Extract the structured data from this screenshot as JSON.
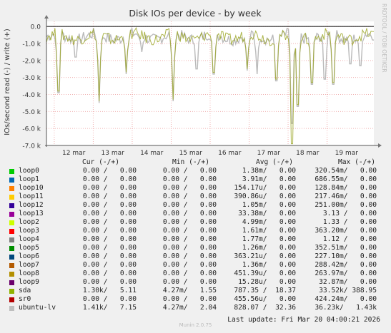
{
  "chart_data": {
    "type": "line",
    "title": "Disk IOs per device - by week",
    "ylabel": "IOs/second read (-) / write (+)",
    "xlabel": "",
    "ylim": [
      -7000,
      300
    ],
    "y_ticks": [
      {
        "value": 0,
        "label": "0.0"
      },
      {
        "value": -1000,
        "label": "-1.0 k"
      },
      {
        "value": -2000,
        "label": "-2.0 k"
      },
      {
        "value": -3000,
        "label": "-3.0 k"
      },
      {
        "value": -4000,
        "label": "-4.0 k"
      },
      {
        "value": -5000,
        "label": "-5.0 k"
      },
      {
        "value": -6000,
        "label": "-6.0 k"
      },
      {
        "value": -7000,
        "label": "-7.0 k"
      }
    ],
    "x_ticks": [
      "12 mar",
      "13 mar",
      "14 mar",
      "15 mar",
      "16 mar",
      "17 mar",
      "18 mar",
      "19 mar"
    ],
    "grid": true,
    "watermark": "RRDTOOL / TOBI OETIKER",
    "series": [
      {
        "name": "ubuntu-lv",
        "color": "#b2b2b2",
        "baseline": -600,
        "spikes": [
          {
            "x": 0.3,
            "y": -3900
          },
          {
            "x": 0.75,
            "y": -1800
          },
          {
            "x": 1.35,
            "y": -4500
          },
          {
            "x": 2.05,
            "y": -2800
          },
          {
            "x": 2.45,
            "y": -1500
          },
          {
            "x": 3.25,
            "y": -4400
          },
          {
            "x": 3.85,
            "y": -2500
          },
          {
            "x": 4.3,
            "y": -2800
          },
          {
            "x": 5.15,
            "y": -2600
          },
          {
            "x": 5.4,
            "y": -2800
          },
          {
            "x": 5.9,
            "y": -3200
          },
          {
            "x": 6.3,
            "y": -5700
          },
          {
            "x": 6.45,
            "y": -4700
          },
          {
            "x": 6.8,
            "y": -3400
          },
          {
            "x": 7.15,
            "y": -3100
          },
          {
            "x": 7.35,
            "y": -3400
          },
          {
            "x": 7.8,
            "y": -2200
          },
          {
            "x": 8.05,
            "y": -2300
          }
        ]
      },
      {
        "name": "sda",
        "color": "#9ea82c",
        "baseline": -600,
        "spikes": [
          {
            "x": 0.3,
            "y": -3800
          },
          {
            "x": 1.35,
            "y": -4400
          },
          {
            "x": 2.05,
            "y": -2700
          },
          {
            "x": 3.25,
            "y": -4300
          },
          {
            "x": 4.3,
            "y": -2700
          },
          {
            "x": 5.15,
            "y": -2500
          },
          {
            "x": 5.9,
            "y": -3100
          },
          {
            "x": 6.3,
            "y": -6900
          },
          {
            "x": 6.45,
            "y": -4600
          },
          {
            "x": 6.8,
            "y": -3300
          },
          {
            "x": 7.35,
            "y": -3300
          }
        ]
      }
    ]
  },
  "legend": {
    "headers": {
      "cur": "Cur (-/+)",
      "min": "Min (-/+)",
      "avg": "Avg (-/+)",
      "max": "Max (-/+)"
    },
    "rows": [
      {
        "name": "loop0",
        "color": "#00cc00",
        "cur": "0.00 /   0.00",
        "min": "0.00 /   0.00",
        "avg": "1.38m/   0.00",
        "max": "320.54m/   0.00"
      },
      {
        "name": "loop1",
        "color": "#0066b3",
        "cur": "0.00 /   0.00",
        "min": "0.00 /   0.00",
        "avg": "3.91m/   0.00",
        "max": "686.55m/   0.00"
      },
      {
        "name": "loop10",
        "color": "#ff8000",
        "cur": "0.00 /   0.00",
        "min": "0.00 /   0.00",
        "avg": "154.17u/   0.00",
        "max": "128.84m/   0.00"
      },
      {
        "name": "loop11",
        "color": "#ffcc00",
        "cur": "0.00 /   0.00",
        "min": "0.00 /   0.00",
        "avg": "390.86u/   0.00",
        "max": "217.46m/   0.00"
      },
      {
        "name": "loop12",
        "color": "#330099",
        "cur": "0.00 /   0.00",
        "min": "0.00 /   0.00",
        "avg": "1.05m/   0.00",
        "max": "251.00m/   0.00"
      },
      {
        "name": "loop13",
        "color": "#990099",
        "cur": "0.00 /   0.00",
        "min": "0.00 /   0.00",
        "avg": "33.38m/   0.00",
        "max": "3.13 /   0.00"
      },
      {
        "name": "loop2",
        "color": "#ccff00",
        "cur": "0.00 /   0.00",
        "min": "0.00 /   0.00",
        "avg": "4.99m/   0.00",
        "max": "1.33 /   0.00"
      },
      {
        "name": "loop3",
        "color": "#ff0000",
        "cur": "0.00 /   0.00",
        "min": "0.00 /   0.00",
        "avg": "1.61m/   0.00",
        "max": "363.20m/   0.00"
      },
      {
        "name": "loop4",
        "color": "#808080",
        "cur": "0.00 /   0.00",
        "min": "0.00 /   0.00",
        "avg": "1.77m/   0.00",
        "max": "1.12 /   0.00"
      },
      {
        "name": "loop5",
        "color": "#008f00",
        "cur": "0.00 /   0.00",
        "min": "0.00 /   0.00",
        "avg": "1.26m/   0.00",
        "max": "352.51m/   0.00"
      },
      {
        "name": "loop6",
        "color": "#00487d",
        "cur": "0.00 /   0.00",
        "min": "0.00 /   0.00",
        "avg": "363.21u/   0.00",
        "max": "227.10m/   0.00"
      },
      {
        "name": "loop7",
        "color": "#b35a00",
        "cur": "0.00 /   0.00",
        "min": "0.00 /   0.00",
        "avg": "1.36m/   0.00",
        "max": "288.42m/   0.00"
      },
      {
        "name": "loop8",
        "color": "#b38f00",
        "cur": "0.00 /   0.00",
        "min": "0.00 /   0.00",
        "avg": "451.39u/   0.00",
        "max": "263.97m/   0.00"
      },
      {
        "name": "loop9",
        "color": "#6b006b",
        "cur": "0.00 /   0.00",
        "min": "0.00 /   0.00",
        "avg": "15.28u/   0.00",
        "max": "32.87m/   0.00"
      },
      {
        "name": "sda",
        "color": "#8fb300",
        "cur": "1.30k/   5.11",
        "min": "4.27m/   1.55",
        "avg": "787.35 /  18.37",
        "max": "33.52k/ 388.95"
      },
      {
        "name": "sr0",
        "color": "#b30000",
        "cur": "0.00 /   0.00",
        "min": "0.00 /   0.00",
        "avg": "455.56u/   0.00",
        "max": "424.24m/   0.00"
      },
      {
        "name": "ubuntu-lv",
        "color": "#bebebe",
        "cur": "1.41k/   7.15",
        "min": "4.27m/   2.04",
        "avg": "828.07 /  32.36",
        "max": "36.23k/   1.43k"
      }
    ]
  },
  "footer": {
    "last_update": "Last update: Fri Mar 20 04:00:21 2026",
    "generator": "Munin 2.0.75"
  }
}
